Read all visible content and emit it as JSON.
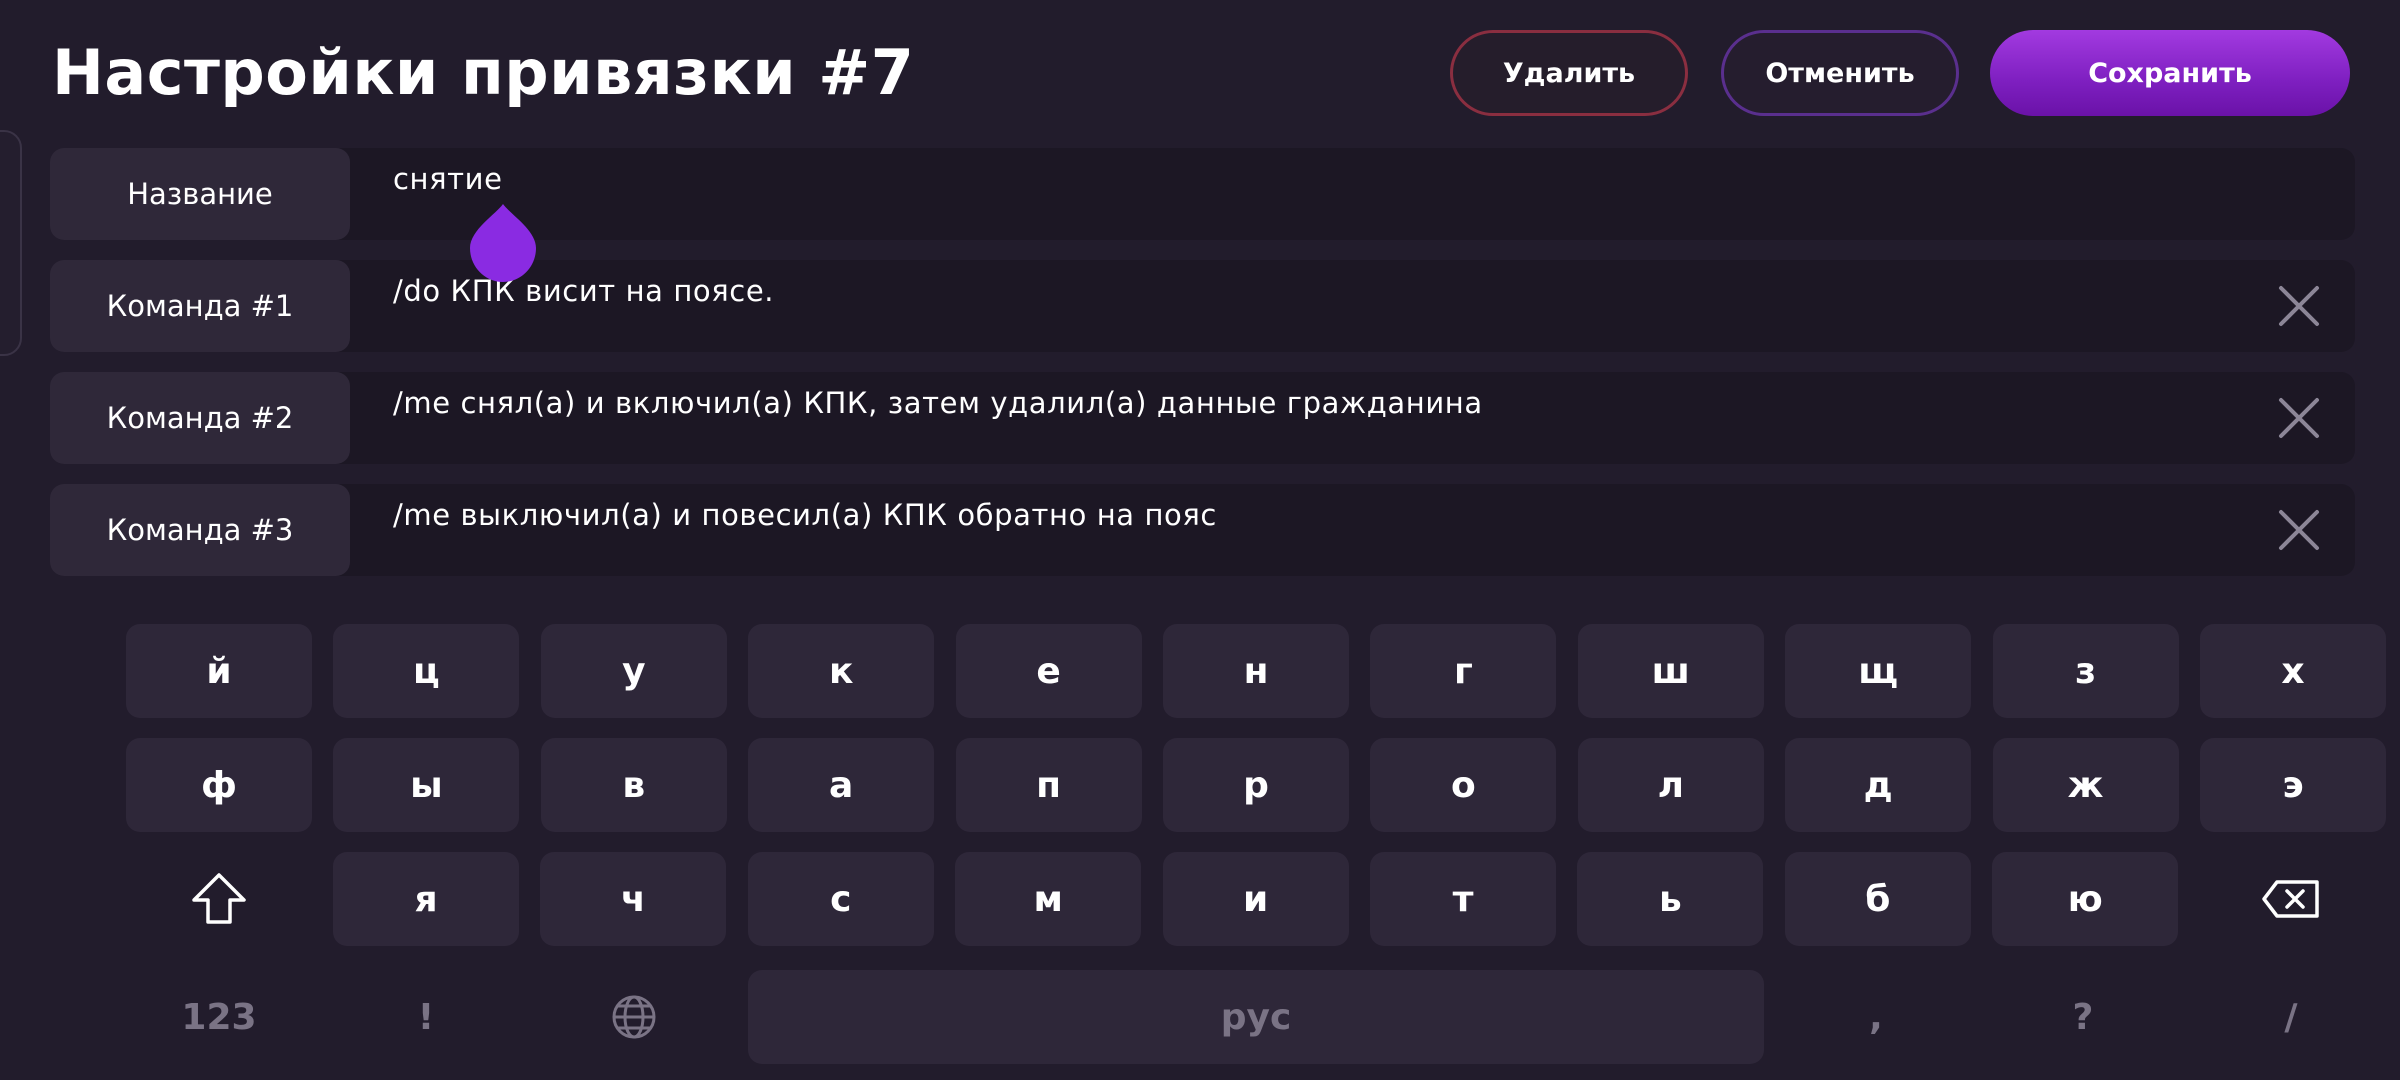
{
  "header": {
    "title": "Настройки привязки #7",
    "delete_label": "Удалить",
    "cancel_label": "Отменить",
    "save_label": "Сохранить"
  },
  "fields": [
    {
      "label": "Название",
      "value": "снятие",
      "clearable": false
    },
    {
      "label": "Команда #1",
      "value": "/do КПК висит на поясе.",
      "clearable": true
    },
    {
      "label": "Команда #2",
      "value": "/me снял(а) и включил(а) КПК, затем удалил(а) данные гражданина",
      "clearable": true
    },
    {
      "label": "Команда #3",
      "value": "/me выключил(а) и повесил(а) КПК обратно на пояс",
      "clearable": true
    }
  ],
  "keyboard": {
    "row1": [
      "й",
      "ц",
      "у",
      "к",
      "е",
      "н",
      "г",
      "ш",
      "щ",
      "з",
      "х"
    ],
    "row2": [
      "ф",
      "ы",
      "в",
      "а",
      "п",
      "р",
      "о",
      "л",
      "д",
      "ж",
      "э"
    ],
    "row3": [
      "я",
      "ч",
      "с",
      "м",
      "и",
      "т",
      "ь",
      "б",
      "ю"
    ],
    "numbers_label": "123",
    "exclaim_label": "!",
    "space_label": "рус",
    "comma_label": ",",
    "question_label": "?",
    "slash_label": "/"
  },
  "colors": {
    "background": "#221c2c",
    "accent": "#8a2be2",
    "delete_border": "#8a2e40",
    "cancel_border": "#5a2f8e"
  },
  "icons": [
    "close-icon",
    "shift-icon",
    "backspace-icon",
    "globe-icon",
    "text-cursor-handle-icon"
  ]
}
